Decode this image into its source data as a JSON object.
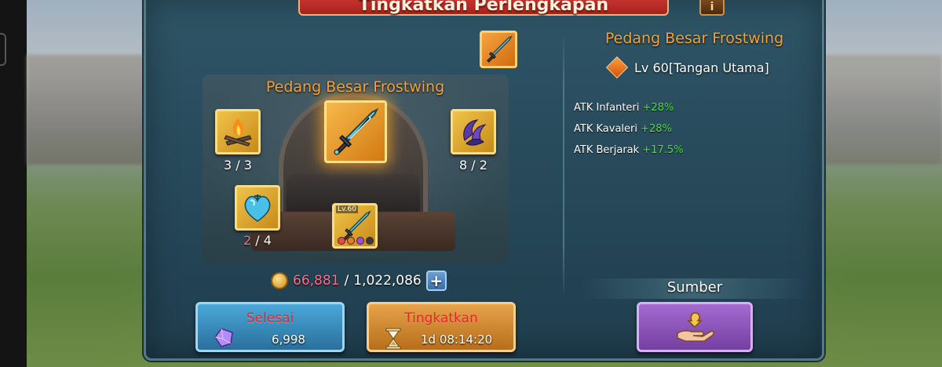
{
  "window": {
    "title": "Tingkatkan Perlengkapan",
    "info_label": "i"
  },
  "item": {
    "name": "Pedang Besar Frostwing",
    "result_level": "Lv.60"
  },
  "materials": [
    {
      "icon": "campfire-icon",
      "owned": "3",
      "required": "3",
      "owned_color": "#ffffff"
    },
    {
      "icon": "claw-icon",
      "owned": "8",
      "required": "2",
      "owned_color": "#ffffff"
    },
    {
      "icon": "frozen-heart-icon",
      "owned": "2",
      "required": "4",
      "owned_color": "#ff6a7a"
    }
  ],
  "material_counts": {
    "campfire": "3 / 3",
    "claw": "8 / 2",
    "heart_owned": "2",
    "heart_sep": " / 4"
  },
  "resource": {
    "icon": "gold-coin-icon",
    "current": "66,881",
    "separator": " / ",
    "required": "1,022,086",
    "add_label": "+"
  },
  "buttons": {
    "finish": {
      "label": "Selesai",
      "cost": "6,998",
      "icon": "gem-crystal-icon"
    },
    "upgrade": {
      "label": "Tingkatkan",
      "time": "1d 08:14:20",
      "icon": "hourglass-icon"
    },
    "source": {
      "icon": "hand-arrow-icon"
    }
  },
  "details": {
    "name": "Pedang Besar Frostwing",
    "level_text": "Lv 60[Tangan Utama]",
    "stats": [
      {
        "label": "ATK Infanteri ",
        "bonus": "+28%"
      },
      {
        "label": "ATK Kavaleri ",
        "bonus": "+28%"
      },
      {
        "label": "ATK Berjarak ",
        "bonus": "+17.5%"
      }
    ],
    "source_heading": "Sumber"
  },
  "colors": {
    "accent_orange": "#f2a33a",
    "bonus_green": "#4ee04a",
    "shortfall_red": "#ff6a7a",
    "button_blue": "#2a6f9c",
    "button_orange": "#b86e1a",
    "button_purple": "#7440a0"
  }
}
